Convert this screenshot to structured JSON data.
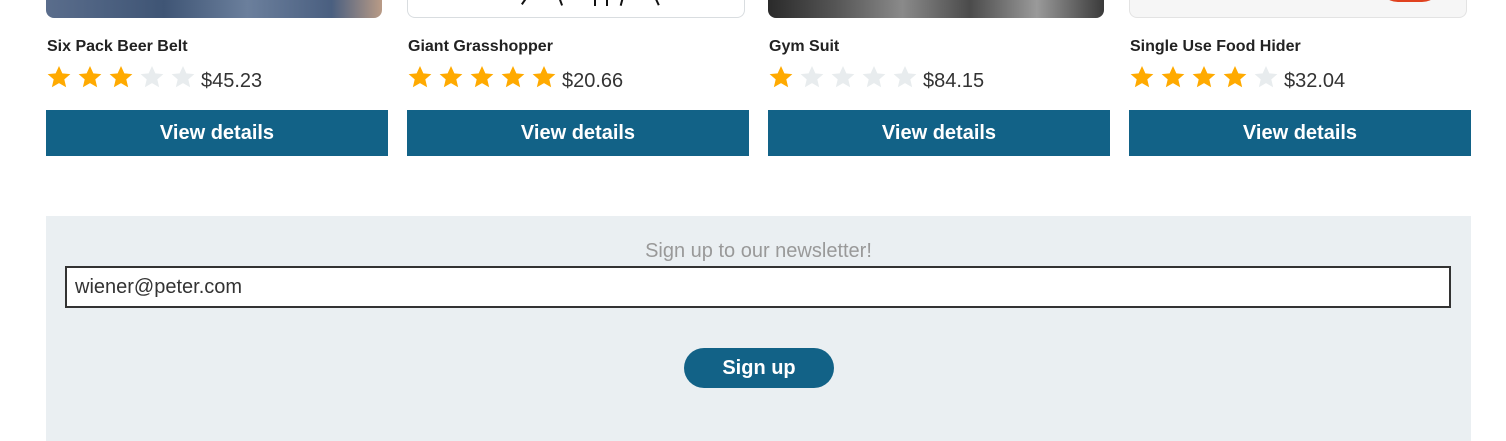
{
  "products": [
    {
      "name": "Six Pack Beer Belt",
      "rating": 3,
      "max_rating": 5,
      "price": "$45.23",
      "button_label": "View details"
    },
    {
      "name": "Giant Grasshopper",
      "rating": 5,
      "max_rating": 5,
      "price": "$20.66",
      "button_label": "View details"
    },
    {
      "name": "Gym Suit",
      "rating": 1,
      "max_rating": 5,
      "price": "$84.15",
      "button_label": "View details"
    },
    {
      "name": "Single Use Food Hider",
      "rating": 4,
      "max_rating": 5,
      "price": "$32.04",
      "button_label": "View details"
    }
  ],
  "newsletter": {
    "heading": "Sign up to our newsletter!",
    "email_value": "wiener@peter.com",
    "button_label": "Sign up"
  },
  "colors": {
    "accent": "#126287",
    "star_filled": "#FFAA00",
    "star_empty": "#E8ECEE",
    "newsletter_bg": "#EAEFF2"
  },
  "icons": {
    "rating_star": "star-icon"
  }
}
